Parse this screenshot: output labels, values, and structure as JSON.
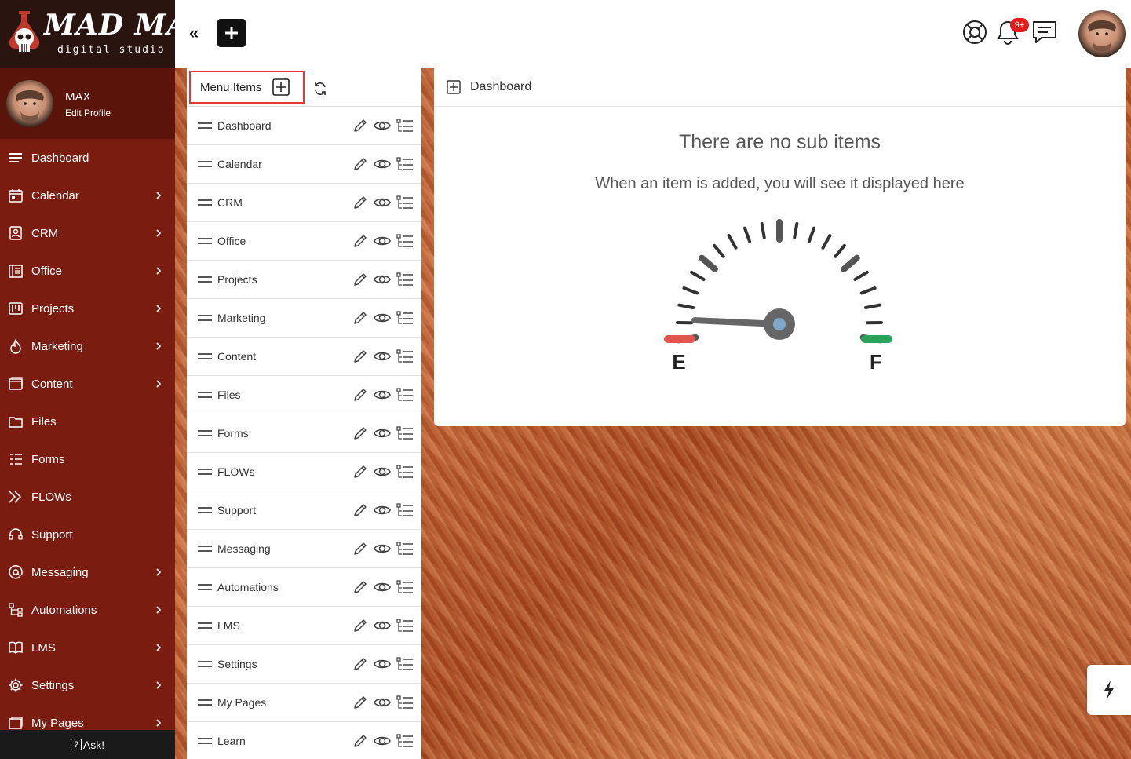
{
  "brand": {
    "name": "MAD MAX",
    "tagline": "digital studio"
  },
  "profile": {
    "name": "MAX",
    "edit_label": "Edit Profile"
  },
  "sidebar": {
    "items": [
      {
        "label": "Dashboard",
        "icon": "dashboard-icon",
        "has_submenu": false
      },
      {
        "label": "Calendar",
        "icon": "calendar-icon",
        "has_submenu": true
      },
      {
        "label": "CRM",
        "icon": "contact-card-icon",
        "has_submenu": true
      },
      {
        "label": "Office",
        "icon": "office-icon",
        "has_submenu": true
      },
      {
        "label": "Projects",
        "icon": "kanban-icon",
        "has_submenu": true
      },
      {
        "label": "Marketing",
        "icon": "flame-icon",
        "has_submenu": true
      },
      {
        "label": "Content",
        "icon": "window-icon",
        "has_submenu": true
      },
      {
        "label": "Files",
        "icon": "folder-icon",
        "has_submenu": false
      },
      {
        "label": "Forms",
        "icon": "list-icon",
        "has_submenu": false
      },
      {
        "label": "FLOWs",
        "icon": "double-chevron-icon",
        "has_submenu": false
      },
      {
        "label": "Support",
        "icon": "headset-icon",
        "has_submenu": false
      },
      {
        "label": "Messaging",
        "icon": "at-icon",
        "has_submenu": true
      },
      {
        "label": "Automations",
        "icon": "flowchart-icon",
        "has_submenu": true
      },
      {
        "label": "LMS",
        "icon": "book-icon",
        "has_submenu": true
      },
      {
        "label": "Settings",
        "icon": "gear-icon",
        "has_submenu": true
      },
      {
        "label": "My Pages",
        "icon": "pages-icon",
        "has_submenu": true
      }
    ],
    "ask_label": "Ask!",
    "ask_icon": "?"
  },
  "topbar": {
    "collapse_label": "«",
    "notification_badge": "9+"
  },
  "menu_panel": {
    "title": "Menu Items",
    "items": [
      "Dashboard",
      "Calendar",
      "CRM",
      "Office",
      "Projects",
      "Marketing",
      "Content",
      "Files",
      "Forms",
      "FLOWs",
      "Support",
      "Messaging",
      "Automations",
      "LMS",
      "Settings",
      "My Pages",
      "Learn"
    ]
  },
  "detail": {
    "breadcrumb": "Dashboard",
    "empty_title": "There are no sub items",
    "empty_subtitle": "When an item is added, you will see it displayed here",
    "gauge_empty": "E",
    "gauge_full": "F",
    "gauge_level": 0.05
  },
  "colors": {
    "sidebar_bg": "#7a1c10",
    "profile_bg": "#5a1409",
    "highlight_border": "#e53935",
    "badge": "#e21b1b",
    "gauge_empty": "#e55353",
    "gauge_full": "#27a35a"
  }
}
